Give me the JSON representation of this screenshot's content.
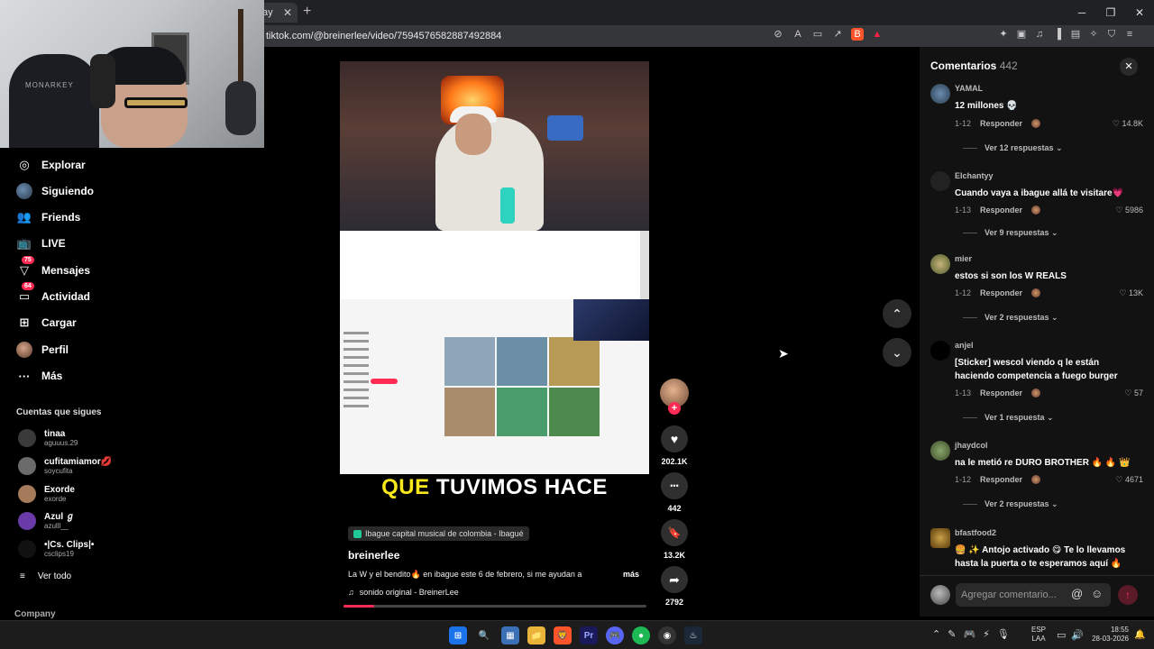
{
  "browser": {
    "tab_label": "ay",
    "tab_close": "✕",
    "new_tab": "+",
    "url": "tiktok.com/@breinerlee/video/7594576582887492884",
    "window_controls": [
      "─",
      "❐",
      "✕"
    ]
  },
  "webcam": {
    "chair_text": "MONARKEY"
  },
  "sidebar": {
    "items": [
      {
        "label": "Explorar",
        "icon": "compass-icon",
        "glyph": "◎"
      },
      {
        "label": "Siguiendo",
        "icon": "following-avatar-icon",
        "glyph": ""
      },
      {
        "label": "Friends",
        "icon": "friends-icon",
        "glyph": "👥"
      },
      {
        "label": "LIVE",
        "icon": "live-icon",
        "glyph": "📺"
      },
      {
        "label": "Mensajes",
        "icon": "messages-icon",
        "glyph": "▽",
        "badge": "75"
      },
      {
        "label": "Actividad",
        "icon": "activity-icon",
        "glyph": "▭",
        "badge": "64"
      },
      {
        "label": "Cargar",
        "icon": "upload-icon",
        "glyph": "⊞"
      },
      {
        "label": "Perfil",
        "icon": "profile-avatar-icon",
        "glyph": ""
      },
      {
        "label": "Más",
        "icon": "more-icon",
        "glyph": "···"
      }
    ],
    "following_title": "Cuentas que sigues",
    "following": [
      {
        "name": "tinaa",
        "user": "aguuus.29"
      },
      {
        "name": "cufitamiamor💋",
        "user": "soycufita"
      },
      {
        "name": "Exorde",
        "user": "exorde"
      },
      {
        "name": "Azul ℊ",
        "user": "azulll__"
      },
      {
        "name": "•|Cs. Clips|•",
        "user": "csclips19"
      }
    ],
    "see_all": "Ver todo",
    "see_all_icon": "≡",
    "company": "Company"
  },
  "video": {
    "caption_highlight": "QUE",
    "caption_rest": "TUVIMOS HACE",
    "location": "Ibague capital musical de colombia - Ibagué",
    "author": "breinerlee",
    "description": "La W y el bendito🔥 en ibague este 6 de febrero, si me ayudan a",
    "more": "más",
    "sound_icon": "♫",
    "sound": "sonido original - BreinerLee",
    "progress": 0.1
  },
  "actions": {
    "follow_plus": "+",
    "likes": "202.1K",
    "comments": "442",
    "saves": "13.2K",
    "shares": "2792",
    "like_glyph": "♥",
    "comment_glyph": "•••",
    "save_glyph": "🔖",
    "share_glyph": "➦"
  },
  "nav": {
    "up": "⌃",
    "down": "⌄"
  },
  "comments_panel": {
    "title": "Comentarios",
    "count": "442",
    "close": "✕",
    "reply_label": "Responder",
    "items": [
      {
        "user": "YAMAL",
        "text": "12 millones 💀",
        "date": "1-12",
        "likes": "♡ 14.8K",
        "replies": "Ver 12 respuestas ⌄"
      },
      {
        "user": "Elchantyy",
        "text": "Cuando vaya a ibague allá te visitare💗",
        "date": "1-13",
        "likes": "♡ 5986",
        "replies": "Ver 9 respuestas ⌄"
      },
      {
        "user": "mier",
        "text": "estos si son los W REALS",
        "date": "1-12",
        "likes": "♡ 13K",
        "replies": "Ver 2 respuestas ⌄"
      },
      {
        "user": "anjel",
        "text": "[Sticker] wescol viendo q le están haciendo competencia a fuego burger",
        "date": "1-13",
        "likes": "♡ 57",
        "replies": "Ver 1 respuesta ⌄"
      },
      {
        "user": "jhaydcol",
        "text": "na le metió re DURO BROTHER 🔥 🔥 👑",
        "date": "1-12",
        "likes": "♡ 4671",
        "replies": "Ver 2 respuestas ⌄"
      },
      {
        "user": "bfastfood2",
        "text": "🍔 ✨ Antojo activado 😋 Te lo llevamos hasta la puerta o te esperamos aquí 🔥",
        "date": "",
        "likes": "",
        "replies": ""
      }
    ],
    "input_placeholder": "Agregar comentario...",
    "at": "@",
    "emoji": "☺",
    "send": "↑"
  },
  "taskbar": {
    "apps": [
      "⊞",
      "🔍",
      "▦",
      "📁",
      "🦁",
      "Pr",
      "🎮",
      "●",
      "◉",
      "♨"
    ],
    "tray_icons": [
      "⌃",
      "✎",
      "🎮",
      "⚡",
      "🎙"
    ],
    "lang_top": "ESP",
    "lang_bottom": "LAA",
    "tray2": [
      "▭",
      "🔊"
    ],
    "time": "18:55",
    "date": "28-03-2026",
    "notif": "🔔"
  }
}
